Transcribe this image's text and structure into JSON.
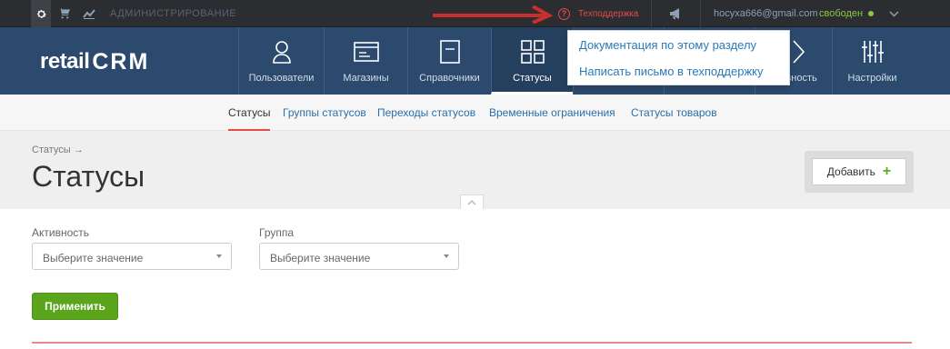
{
  "topbar": {
    "admin_label": "АДМИНИСТРИРОВАНИЕ",
    "support_label": "Техподдержка",
    "user_email": "hocyxa666@gmail.com",
    "user_status": "свободен"
  },
  "logo": {
    "part1": "retail",
    "part2": "CRM"
  },
  "nav": {
    "items": [
      {
        "label": "Пользователи",
        "icon": "user-icon"
      },
      {
        "label": "Магазины",
        "icon": "store-icon"
      },
      {
        "label": "Справочники",
        "icon": "book-icon"
      },
      {
        "label": "Статусы",
        "icon": "statuses-icon",
        "active": true
      },
      {
        "label": "…ивность",
        "icon": "activity-icon"
      },
      {
        "label": "Настройки",
        "icon": "sliders-icon"
      }
    ]
  },
  "dropdown": {
    "items": [
      "Документация по этому разделу",
      "Написать письмо в техподдержку"
    ]
  },
  "subnav": {
    "items": [
      "Статусы",
      "Группы статусов",
      "Переходы статусов",
      "Временные ограничения",
      "Статусы товаров"
    ],
    "active_index": 0
  },
  "page": {
    "breadcrumb": "Статусы →",
    "title": "Статусы",
    "add_button": "Добавить"
  },
  "filters": {
    "activity_label": "Активность",
    "activity_placeholder": "Выберите значение",
    "group_label": "Группа",
    "group_placeholder": "Выберите значение",
    "apply_button": "Применить"
  },
  "colors": {
    "topbar_bg": "#2b2d31",
    "nav_bg": "#2c4a6d",
    "accent_red": "#e34b4b",
    "apply_green": "#5aa51c",
    "link_blue": "#2a7ab7"
  }
}
